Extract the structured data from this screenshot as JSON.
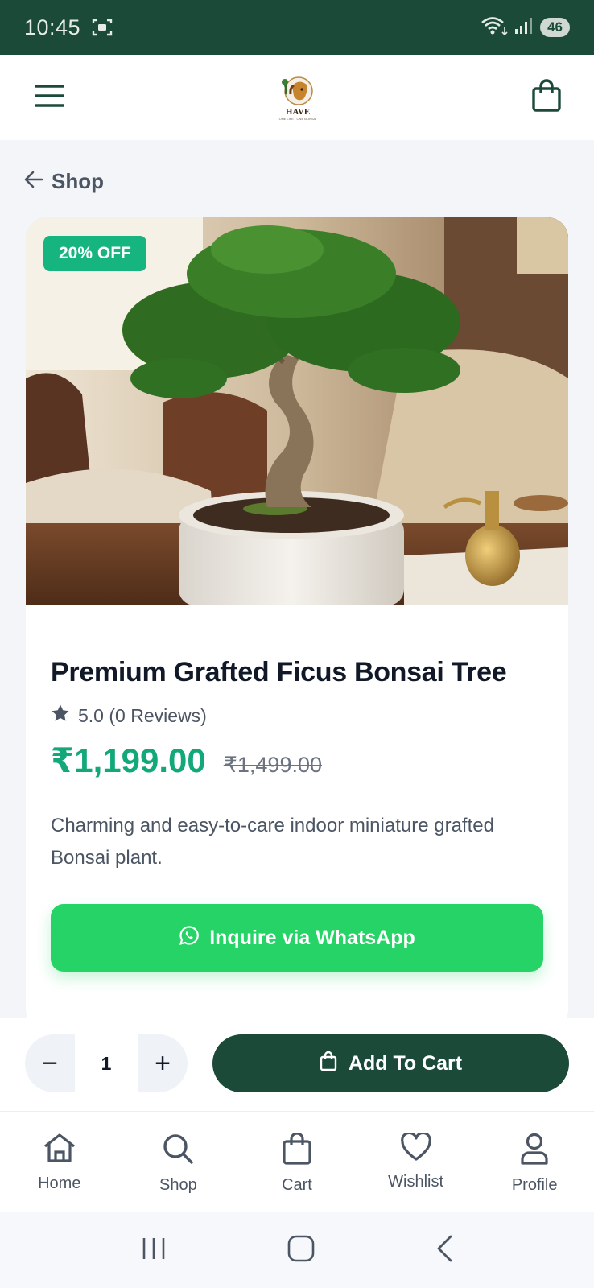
{
  "status_bar": {
    "time": "10:45",
    "battery": "46",
    "wifi_badge": "5"
  },
  "header": {
    "logo_text": "HAVE",
    "logo_subtext": "ONE LIFE · ONE BONSAI"
  },
  "back_link": {
    "label": "Shop"
  },
  "product": {
    "discount_badge": "20% OFF",
    "title": "Premium Grafted Ficus Bonsai Tree",
    "rating": "5.0 (0 Reviews)",
    "price": "₹1,199.00",
    "original_price": "₹1,499.00",
    "description": "Charming and easy-to-care indoor miniature grafted Bonsai plant.",
    "whatsapp_label": "Inquire via WhatsApp"
  },
  "cart_bar": {
    "quantity": "1",
    "minus": "−",
    "plus": "+",
    "add_to_cart_label": "Add To Cart"
  },
  "bottom_nav": {
    "items": [
      {
        "label": "Home",
        "icon": "home-icon"
      },
      {
        "label": "Shop",
        "icon": "search-icon"
      },
      {
        "label": "Cart",
        "icon": "bag-icon"
      },
      {
        "label": "Wishlist",
        "icon": "heart-icon"
      },
      {
        "label": "Profile",
        "icon": "user-icon"
      }
    ]
  },
  "colors": {
    "primary": "#1b4a38",
    "accent": "#13a87a",
    "whatsapp": "#25d366",
    "badge": "#16b57f"
  }
}
